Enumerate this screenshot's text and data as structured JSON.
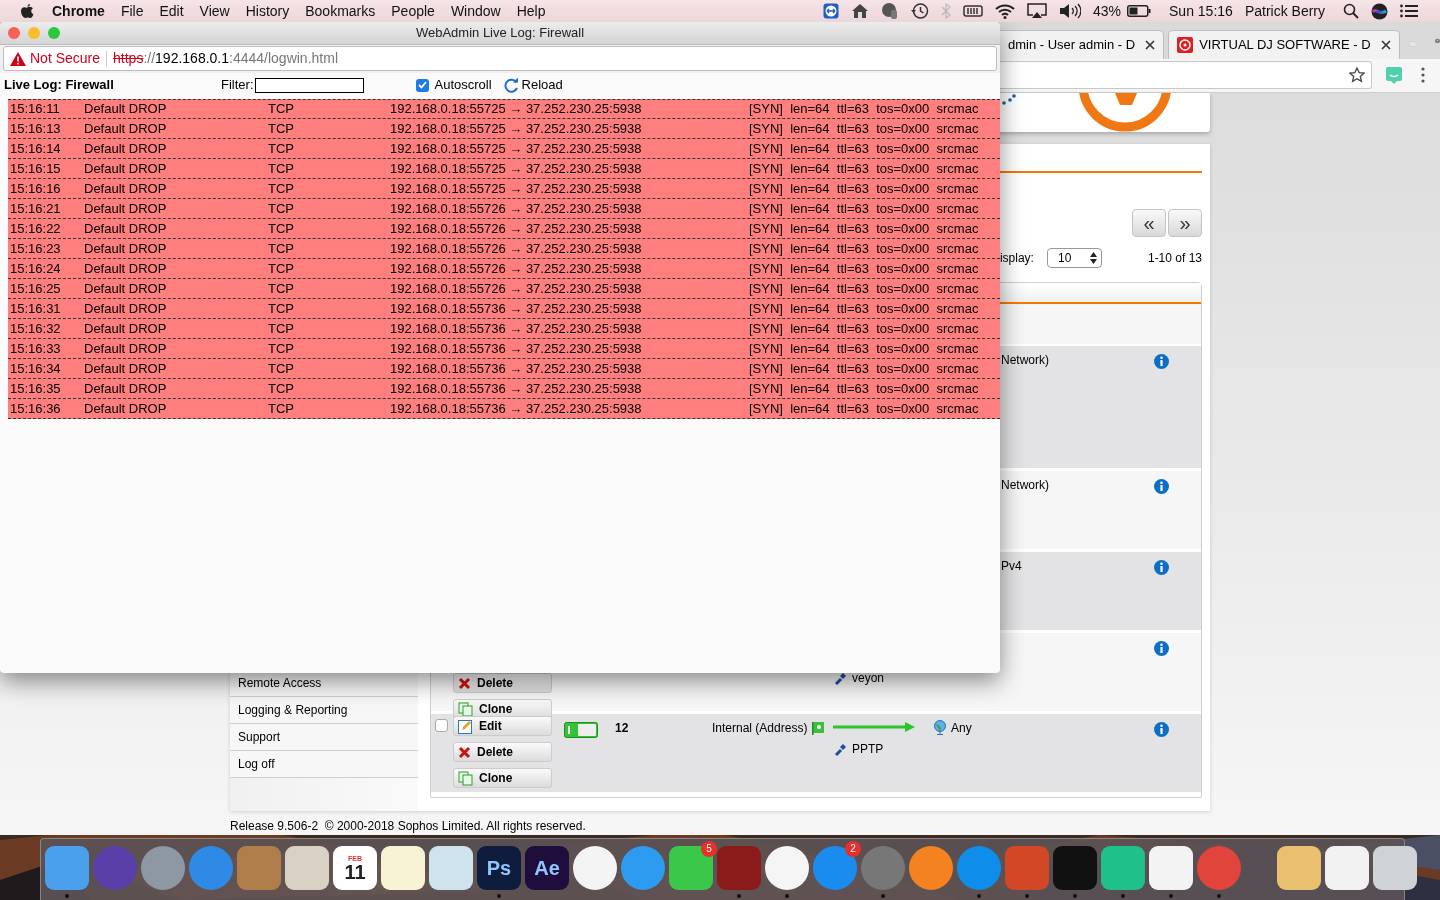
{
  "menubar": {
    "app": "Chrome",
    "menus": [
      "File",
      "Edit",
      "View",
      "History",
      "Bookmarks",
      "People",
      "Window",
      "Help"
    ],
    "battery": "43%",
    "clock": "Sun 15:16",
    "user": "Patrick Berry"
  },
  "browser": {
    "tabs": [
      {
        "title": "dmin - User admin - D",
        "favicon": false
      },
      {
        "title": "VIRTUAL DJ SOFTWARE - D",
        "favicon": true
      }
    ]
  },
  "page": {
    "pager": {
      "prev": "«",
      "next": "»"
    },
    "display_label": "isplay:",
    "display_value": "10",
    "range": "1-10 of 13",
    "nav": [
      "Remote Access",
      "Logging & Reporting",
      "Support",
      "Log off"
    ],
    "rules": [
      {
        "dest_tail": "Network)"
      },
      {
        "dest_tail": "Network)"
      },
      {
        "dest_tail": "Pv4"
      },
      {
        "buttons": [
          {
            "kind": "delete",
            "label": "Delete"
          },
          {
            "kind": "clone",
            "label": "Clone"
          }
        ],
        "service": "veyon"
      },
      {
        "checked": false,
        "buttons": [
          {
            "kind": "edit",
            "label": "Edit"
          },
          {
            "kind": "delete",
            "label": "Delete"
          },
          {
            "kind": "clone",
            "label": "Clone"
          }
        ],
        "enabled": true,
        "number": "12",
        "source": "Internal (Address)",
        "arrow": true,
        "service": "PPTP",
        "dest": "Any"
      }
    ],
    "footer": "Release 9.506-2  © 2000-2018 Sophos Limited. All rights reserved."
  },
  "popup": {
    "title": "WebAdmin Live Log: Firewall",
    "security": "Not Secure",
    "url": "https://192.168.0.1:4444/logwin.html",
    "log_title": "Live Log: Firewall",
    "filter_label": "Filter:",
    "autoscroll": {
      "label": "Autoscroll",
      "checked": true
    },
    "reload": "Reload",
    "rows": [
      {
        "time": "15:16:11",
        "rule": "Default DROP",
        "proto": "TCP",
        "connection": "192.168.0.18:55725 → 37.252.230.25:5938",
        "details": "[SYN]  len=64  ttl=63  tos=0x00  srcmac"
      },
      {
        "time": "15:16:13",
        "rule": "Default DROP",
        "proto": "TCP",
        "connection": "192.168.0.18:55725 → 37.252.230.25:5938",
        "details": "[SYN]  len=64  ttl=63  tos=0x00  srcmac"
      },
      {
        "time": "15:16:14",
        "rule": "Default DROP",
        "proto": "TCP",
        "connection": "192.168.0.18:55725 → 37.252.230.25:5938",
        "details": "[SYN]  len=64  ttl=63  tos=0x00  srcmac"
      },
      {
        "time": "15:16:15",
        "rule": "Default DROP",
        "proto": "TCP",
        "connection": "192.168.0.18:55725 → 37.252.230.25:5938",
        "details": "[SYN]  len=64  ttl=63  tos=0x00  srcmac"
      },
      {
        "time": "15:16:16",
        "rule": "Default DROP",
        "proto": "TCP",
        "connection": "192.168.0.18:55725 → 37.252.230.25:5938",
        "details": "[SYN]  len=64  ttl=63  tos=0x00  srcmac"
      },
      {
        "time": "15:16:21",
        "rule": "Default DROP",
        "proto": "TCP",
        "connection": "192.168.0.18:55726 → 37.252.230.25:5938",
        "details": "[SYN]  len=64  ttl=63  tos=0x00  srcmac"
      },
      {
        "time": "15:16:22",
        "rule": "Default DROP",
        "proto": "TCP",
        "connection": "192.168.0.18:55726 → 37.252.230.25:5938",
        "details": "[SYN]  len=64  ttl=63  tos=0x00  srcmac"
      },
      {
        "time": "15:16:23",
        "rule": "Default DROP",
        "proto": "TCP",
        "connection": "192.168.0.18:55726 → 37.252.230.25:5938",
        "details": "[SYN]  len=64  ttl=63  tos=0x00  srcmac"
      },
      {
        "time": "15:16:24",
        "rule": "Default DROP",
        "proto": "TCP",
        "connection": "192.168.0.18:55726 → 37.252.230.25:5938",
        "details": "[SYN]  len=64  ttl=63  tos=0x00  srcmac"
      },
      {
        "time": "15:16:25",
        "rule": "Default DROP",
        "proto": "TCP",
        "connection": "192.168.0.18:55726 → 37.252.230.25:5938",
        "details": "[SYN]  len=64  ttl=63  tos=0x00  srcmac"
      },
      {
        "time": "15:16:31",
        "rule": "Default DROP",
        "proto": "TCP",
        "connection": "192.168.0.18:55736 → 37.252.230.25:5938",
        "details": "[SYN]  len=64  ttl=63  tos=0x00  srcmac"
      },
      {
        "time": "15:16:32",
        "rule": "Default DROP",
        "proto": "TCP",
        "connection": "192.168.0.18:55736 → 37.252.230.25:5938",
        "details": "[SYN]  len=64  ttl=63  tos=0x00  srcmac"
      },
      {
        "time": "15:16:33",
        "rule": "Default DROP",
        "proto": "TCP",
        "connection": "192.168.0.18:55736 → 37.252.230.25:5938",
        "details": "[SYN]  len=64  ttl=63  tos=0x00  srcmac"
      },
      {
        "time": "15:16:34",
        "rule": "Default DROP",
        "proto": "TCP",
        "connection": "192.168.0.18:55736 → 37.252.230.25:5938",
        "details": "[SYN]  len=64  ttl=63  tos=0x00  srcmac"
      },
      {
        "time": "15:16:35",
        "rule": "Default DROP",
        "proto": "TCP",
        "connection": "192.168.0.18:55736 → 37.252.230.25:5938",
        "details": "[SYN]  len=64  ttl=63  tos=0x00  srcmac"
      },
      {
        "time": "15:16:36",
        "rule": "Default DROP",
        "proto": "TCP",
        "connection": "192.168.0.18:55736 → 37.252.230.25:5938",
        "details": "[SYN]  len=64  ttl=63  tos=0x00  srcmac"
      }
    ]
  },
  "dock": {
    "apps": [
      {
        "kind": "tile",
        "color": "#4aa0ec",
        "running": true
      },
      {
        "kind": "circle",
        "color": "#5b3fa8",
        "running": false
      },
      {
        "kind": "circle",
        "color": "#8d98a4",
        "running": false
      },
      {
        "kind": "circle",
        "color": "#2f8ae5",
        "running": false
      },
      {
        "kind": "tile",
        "color": "#b07e4a",
        "running": false
      },
      {
        "kind": "tile",
        "color": "#d9d2c4",
        "running": false
      },
      {
        "kind": "tile",
        "color": "#ffffff",
        "running": false,
        "caption": "FEB",
        "label": "11"
      },
      {
        "kind": "tile",
        "color": "#f7f3d4",
        "running": false
      },
      {
        "kind": "tile",
        "color": "#cfe3ee",
        "running": false
      },
      {
        "kind": "tile",
        "color": "#0e1d3d",
        "running": true,
        "label": "Ps"
      },
      {
        "kind": "tile",
        "color": "#1f0e3d",
        "running": false,
        "label": "Ae"
      },
      {
        "kind": "circle",
        "color": "#f4f4f4",
        "running": false
      },
      {
        "kind": "circle",
        "color": "#2d9cf0",
        "running": false
      },
      {
        "kind": "tile",
        "color": "#3bc84a",
        "running": false,
        "badge": "5"
      },
      {
        "kind": "tile",
        "color": "#8b1b1b",
        "running": true
      },
      {
        "kind": "circle",
        "color": "#f5f5f5",
        "running": true
      },
      {
        "kind": "circle",
        "color": "#1a8cf0",
        "running": false,
        "badge": "2"
      },
      {
        "kind": "circle",
        "color": "#777777",
        "running": true
      },
      {
        "kind": "circle",
        "color": "#f58220",
        "running": false
      },
      {
        "kind": "circle",
        "color": "#0e8ee9",
        "running": true
      },
      {
        "kind": "tile",
        "color": "#d24726",
        "running": true
      },
      {
        "kind": "tile",
        "color": "#111111",
        "running": true
      },
      {
        "kind": "tile",
        "color": "#1fc08a",
        "running": true
      },
      {
        "kind": "tile",
        "color": "#f3f3f3",
        "running": true
      },
      {
        "kind": "circle",
        "color": "#e0443a",
        "running": true
      }
    ],
    "others": [
      {
        "kind": "tile",
        "color": "#e8c070",
        "running": false
      },
      {
        "kind": "tile",
        "color": "#f2f2f2",
        "running": false
      },
      {
        "kind": "tile",
        "color": "#cfd3d6",
        "running": false
      }
    ]
  }
}
